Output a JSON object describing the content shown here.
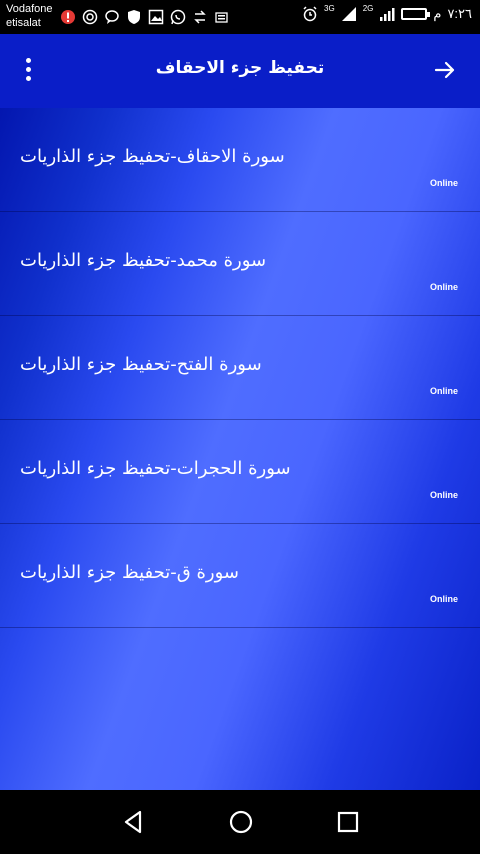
{
  "status_bar": {
    "carrier_1": "Vodafone",
    "carrier_2": "etisalat",
    "net_1": "3G",
    "net_2": "2G",
    "am_pm": "م",
    "time": "٧:٢٦"
  },
  "toolbar": {
    "title": "تحفيظ جزء الاحقاف"
  },
  "list": {
    "items": [
      {
        "label": "سورة الاحقاف-تحفيظ جزء الذاريات",
        "status": "Online"
      },
      {
        "label": "سورة محمد-تحفيظ جزء الذاريات",
        "status": "Online"
      },
      {
        "label": "سورة الفتح-تحفيظ جزء الذاريات",
        "status": "Online"
      },
      {
        "label": "سورة الحجرات-تحفيظ جزء الذاريات",
        "status": "Online"
      },
      {
        "label": "سورة ق-تحفيظ جزء الذاريات",
        "status": "Online"
      }
    ]
  },
  "icons": {
    "menu": "more-vert-icon",
    "back": "arrow-icon",
    "nav_back": "nav-back-icon",
    "nav_home": "nav-home-icon",
    "nav_recent": "nav-recent-icon"
  },
  "colors": {
    "toolbar": "#0a1ec8",
    "background_dark": "#0010a8",
    "background_light": "#4f6dff",
    "text": "#ffffff"
  }
}
